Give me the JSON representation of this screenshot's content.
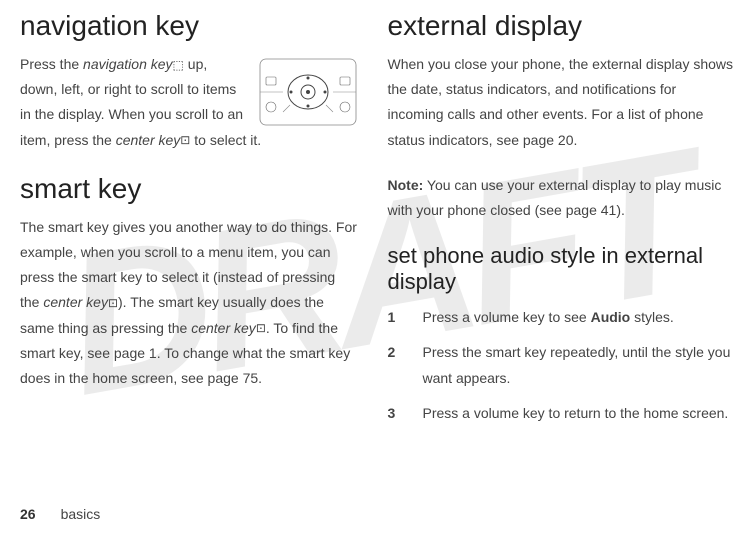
{
  "watermark": "DRAFT",
  "left": {
    "navKey": {
      "heading": "navigation key",
      "body_p1": "Press the ",
      "body_p2": "navigation key",
      "body_p3": " ",
      "body_p4": " up, down, left, or right to scroll to items in the display. When you scroll to an item, press the ",
      "body_p5": "center key",
      "body_p6": " to select it."
    },
    "smartKey": {
      "heading": "smart key",
      "body_p1": "The smart key gives you another way to do things. For example, when you scroll to a menu item, you can press the smart key to select it (instead of pressing the ",
      "body_p2": "center key",
      "body_p3": "). The smart key usually does the same thing as pressing the ",
      "body_p4": "center key",
      "body_p5": ". To find the smart key, see page 1. To change what the smart key does in the home screen, see page 75."
    }
  },
  "right": {
    "extDisplay": {
      "heading": "external display",
      "body": "When you close your phone, the external display shows the date, status indicators, and notifications for incoming calls and other events. For a list of phone status indicators, see page 20.",
      "note_label": "Note:",
      "note_body": " You can use your external display to play music with your phone closed (see page 41)."
    },
    "audioStyle": {
      "heading": "set phone audio style in external display",
      "step1": "Press a volume key to see ",
      "step1_bold": "Audio",
      "step1_end": " styles.",
      "step2": "Press the smart key repeatedly, until the style you want appears.",
      "step3": "Press a volume key to return to the home screen."
    }
  },
  "footer": {
    "page": "26",
    "label": "basics"
  }
}
